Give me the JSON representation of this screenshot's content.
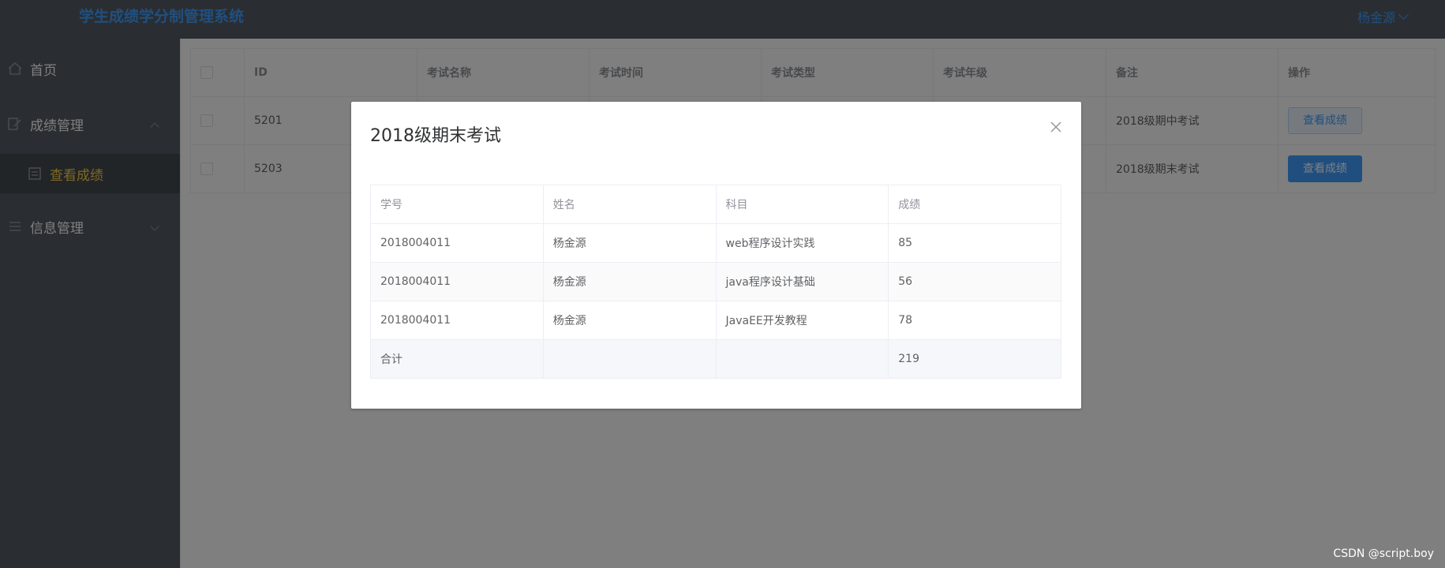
{
  "header": {
    "title": "学生成绩学分制管理系统",
    "user_name": "杨金源"
  },
  "sidebar": {
    "items": [
      {
        "label": "首页",
        "icon": "home-icon"
      },
      {
        "label": "成绩管理",
        "icon": "edit-icon"
      },
      {
        "label": "查看成绩",
        "icon": "document-icon"
      },
      {
        "label": "信息管理",
        "icon": "menu-icon"
      }
    ]
  },
  "exam_table": {
    "headers": [
      "ID",
      "考试名称",
      "考试时间",
      "考试类型",
      "考试年级",
      "备注",
      "操作"
    ],
    "rows": [
      {
        "id": "5201",
        "remark": "2018级期中考试",
        "action": "查看成绩"
      },
      {
        "id": "5203",
        "remark": "2018级期末考试",
        "action": "查看成绩"
      }
    ]
  },
  "dialog": {
    "title": "2018级期末考试",
    "headers": [
      "学号",
      "姓名",
      "科目",
      "成绩"
    ],
    "rows": [
      [
        "2018004011",
        "杨金源",
        "web程序设计实践",
        "85"
      ],
      [
        "2018004011",
        "杨金源",
        "java程序设计基础",
        "56"
      ],
      [
        "2018004011",
        "杨金源",
        "JavaEE开发教程",
        "78"
      ]
    ],
    "summary": {
      "label": "合计",
      "total": "219"
    }
  },
  "watermark": "CSDN @script.boy",
  "colors": {
    "sidebar_bg": "#545c64",
    "accent": "#409eff",
    "active_menu": "#ffd04b"
  }
}
